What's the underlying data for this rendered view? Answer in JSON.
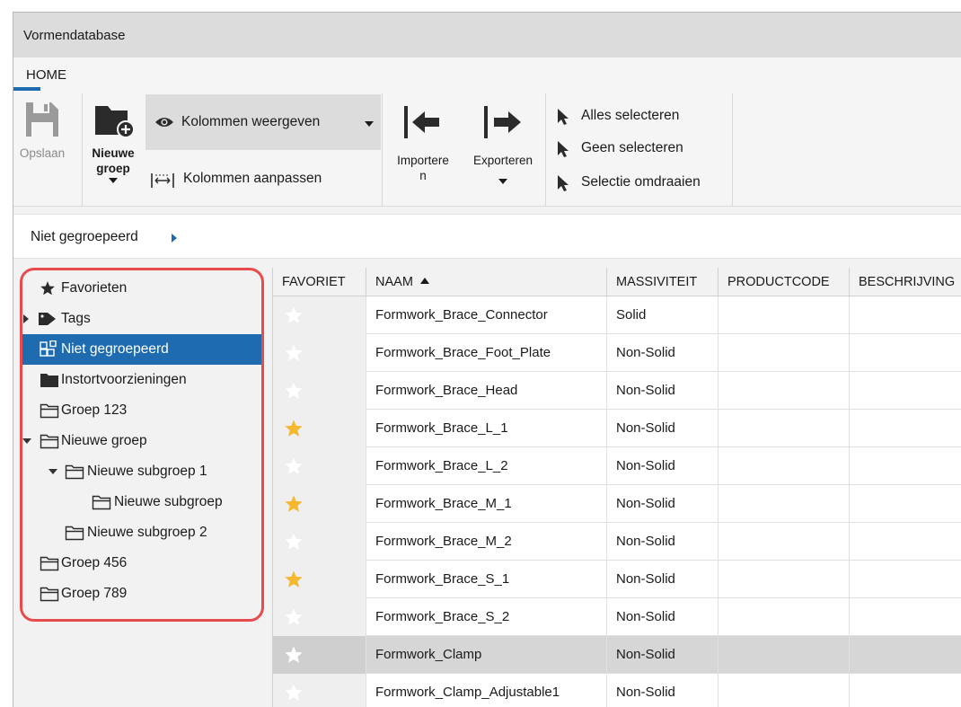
{
  "window": {
    "title": "Vormendatabase"
  },
  "tabs": [
    {
      "label": "HOME",
      "active": true
    }
  ],
  "ribbon": {
    "save": {
      "label": "Opslaan",
      "icon": "save-icon",
      "enabled": false
    },
    "new_group": {
      "label_line1": "Nieuwe",
      "label_line2": "groep",
      "icon": "folder-add-icon"
    },
    "show_columns": {
      "label": "Kolommen weergeven",
      "icon": "eye-icon"
    },
    "fit_columns": {
      "label": "Kolommen aanpassen",
      "icon": "column-width-icon"
    },
    "import": {
      "label_line1": "Importere",
      "label_line2": "n",
      "icon": "arrow-left-icon"
    },
    "export": {
      "label": "Exporteren",
      "icon": "arrow-right-icon"
    },
    "select_all": {
      "label": "Alles selecteren",
      "icon": "cursor-icon"
    },
    "select_none": {
      "label": "Geen selecteren",
      "icon": "cursor-icon"
    },
    "select_invert": {
      "label": "Selectie omdraaien",
      "icon": "cursor-icon"
    }
  },
  "breadcrumb": {
    "label": "Niet gegroepeerd"
  },
  "tree": [
    {
      "label": "Favorieten",
      "icon": "star-icon"
    },
    {
      "label": "Tags",
      "icon": "tag-icon",
      "expander": "collapsed"
    },
    {
      "label": "Niet gegroepeerd",
      "icon": "ungrouped-icon",
      "selected": true
    },
    {
      "label": "Instortvoorzieningen",
      "icon": "folder-icon"
    },
    {
      "label": "Groep 123",
      "icon": "group-folder-icon"
    },
    {
      "label": "Nieuwe groep",
      "icon": "group-folder-icon",
      "expander": "expanded"
    },
    {
      "label": "Nieuwe subgroep 1",
      "icon": "group-folder-icon",
      "expander": "expanded"
    },
    {
      "label": "Nieuwe subgroep",
      "icon": "group-folder-icon"
    },
    {
      "label": "Nieuwe subgroep 2",
      "icon": "group-folder-icon"
    },
    {
      "label": "Groep 456",
      "icon": "group-folder-icon"
    },
    {
      "label": "Groep 789",
      "icon": "group-folder-icon"
    }
  ],
  "table": {
    "columns": [
      "FAVORIET",
      "NAAM",
      "MASSIVITEIT",
      "PRODUCTCODE",
      "BESCHRIJVING"
    ],
    "sort_column": "NAAM",
    "rows": [
      {
        "favorite": false,
        "name": "Formwork_Brace_Connector",
        "massiviteit": "Solid",
        "productcode": "",
        "beschrijving": ""
      },
      {
        "favorite": false,
        "name": "Formwork_Brace_Foot_Plate",
        "massiviteit": "Non-Solid",
        "productcode": "",
        "beschrijving": ""
      },
      {
        "favorite": false,
        "name": "Formwork_Brace_Head",
        "massiviteit": "Non-Solid",
        "productcode": "",
        "beschrijving": ""
      },
      {
        "favorite": true,
        "name": "Formwork_Brace_L_1",
        "massiviteit": "Non-Solid",
        "productcode": "",
        "beschrijving": ""
      },
      {
        "favorite": false,
        "name": "Formwork_Brace_L_2",
        "massiviteit": "Non-Solid",
        "productcode": "",
        "beschrijving": ""
      },
      {
        "favorite": true,
        "name": "Formwork_Brace_M_1",
        "massiviteit": "Non-Solid",
        "productcode": "",
        "beschrijving": ""
      },
      {
        "favorite": false,
        "name": "Formwork_Brace_M_2",
        "massiviteit": "Non-Solid",
        "productcode": "",
        "beschrijving": ""
      },
      {
        "favorite": true,
        "name": "Formwork_Brace_S_1",
        "massiviteit": "Non-Solid",
        "productcode": "",
        "beschrijving": ""
      },
      {
        "favorite": false,
        "name": "Formwork_Brace_S_2",
        "massiviteit": "Non-Solid",
        "productcode": "",
        "beschrijving": ""
      },
      {
        "favorite": false,
        "name": "Formwork_Clamp",
        "massiviteit": "Non-Solid",
        "productcode": "",
        "beschrijving": "",
        "selected": true
      },
      {
        "favorite": false,
        "name": "Formwork_Clamp_Adjustable1",
        "massiviteit": "Non-Solid",
        "productcode": "",
        "beschrijving": ""
      }
    ]
  },
  "colors": {
    "accent": "#1e6bb0",
    "favorite_star": "#f5b82e",
    "highlight": "#e84b4b"
  }
}
